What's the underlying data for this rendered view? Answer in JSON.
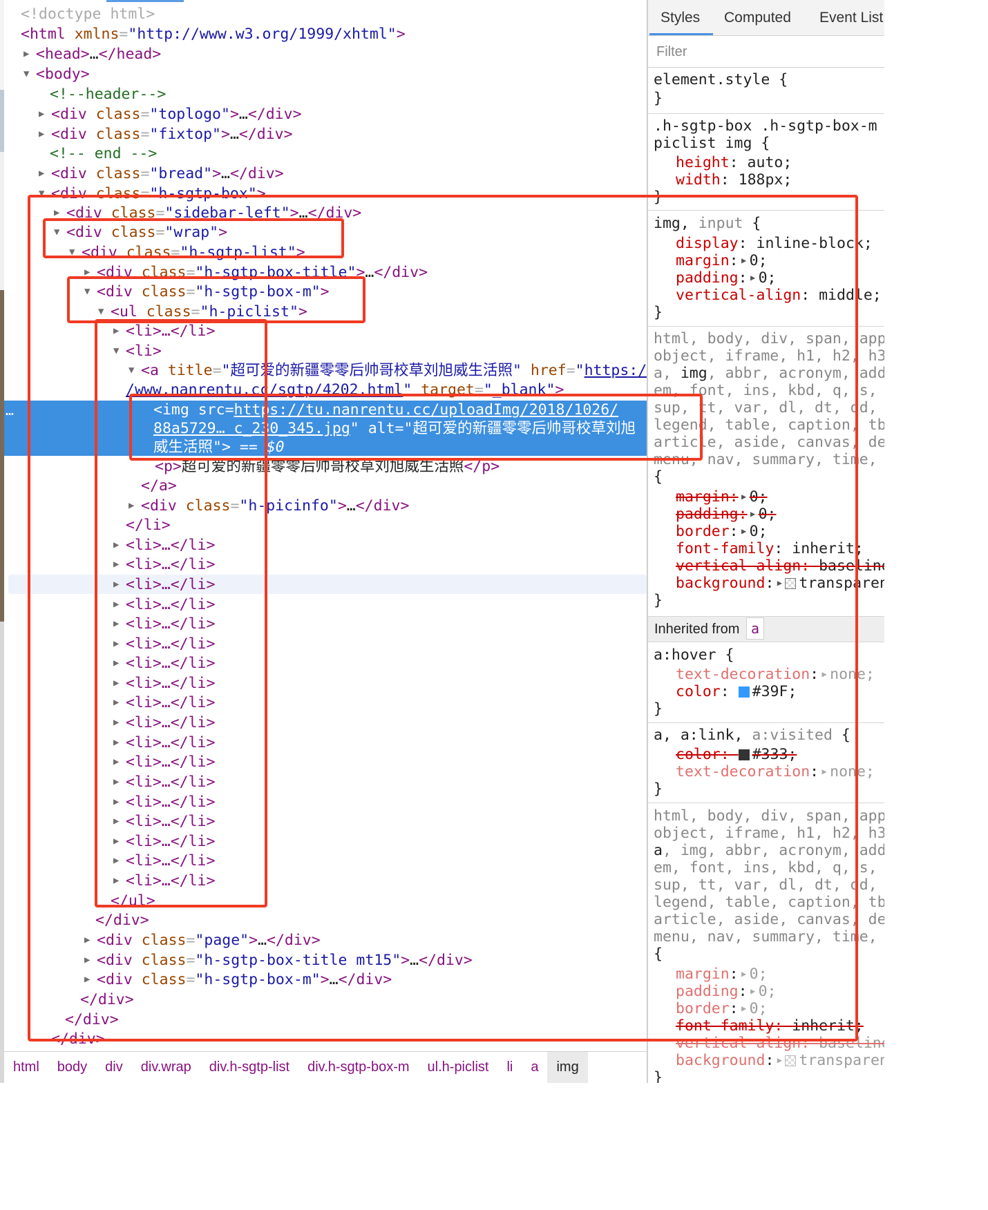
{
  "colors": {
    "tag": "#881280",
    "attr_name": "#994500",
    "attr_value": "#1a1aa6",
    "comment": "#236e25",
    "selection": "#3d8fe0",
    "css_property": "#c80000",
    "annotation_red": "#f03a24"
  },
  "elements": {
    "doctype": "<!doctype html>",
    "html_xmlns": "http://www.w3.org/1999/xhtml",
    "comment_header": "<!--header-->",
    "comment_end": "<!-- end -->",
    "class_toplogo": "toplogo",
    "class_fixtop": "fixtop",
    "class_bread": "bread",
    "class_sgtp_box": "h-sgtp-box",
    "class_sidebar_left": "sidebar-left",
    "class_wrap": "wrap",
    "class_sgtp_list": "h-sgtp-list",
    "class_box_title": "h-sgtp-box-title",
    "class_box_m": "h-sgtp-box-m",
    "class_piclist": "h-piclist",
    "a_title": "超可爱的新疆零零后帅哥校草刘旭威生活照",
    "a_href_part1": "https:/",
    "a_href_part2": "/www.nanrentu.cc/sgtp/4202.html",
    "a_target": "_blank",
    "img_src_part1": "https://tu.nanrentu.cc/uploadImg/2018/1026/",
    "img_src_part2": "88a5729… c_230_345.jpg",
    "img_alt_part1": "超可爱的新疆零零后帅哥校草刘旭",
    "img_alt_part2": "威生活照",
    "selected_marker": "== $0",
    "ellipsis": "…",
    "p_text": "超可爱的新疆零零后帅哥校草刘旭威生活照",
    "class_picinfo": "h-picinfo",
    "class_page": "page",
    "class_box_title_mt15": "h-sgtp-box-title mt15",
    "collapsed_li": "<li>…</li>"
  },
  "breadcrumb": [
    "html",
    "body",
    "div",
    "div.wrap",
    "div.h-sgtp-list",
    "div.h-sgtp-box-m",
    "ul.h-piclist",
    "li",
    "a",
    "img"
  ],
  "styles_pane": {
    "tabs": [
      "Styles",
      "Computed",
      "Event List"
    ],
    "filter_placeholder": "Filter",
    "inherited_label": "Inherited from",
    "inherited_tag": "a"
  }
}
